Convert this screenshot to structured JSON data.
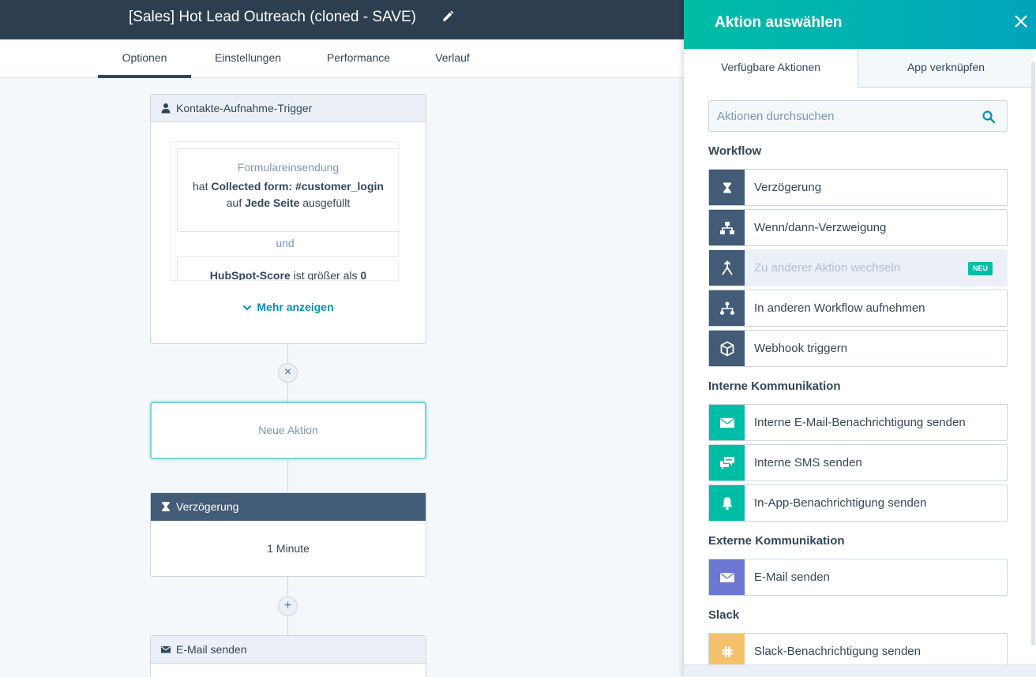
{
  "header": {
    "title": "[Sales] Hot Lead Outreach (cloned - SAVE)",
    "tabs": [
      {
        "label": "Optionen",
        "active": true
      },
      {
        "label": "Einstellungen",
        "active": false
      },
      {
        "label": "Performance",
        "active": false
      },
      {
        "label": "Verlauf",
        "active": false
      }
    ]
  },
  "canvas": {
    "trigger": {
      "title": "Kontakte-Aufnahme-Trigger",
      "filter1": {
        "title": "Formulareinsendung",
        "line1_prefix": "hat",
        "line1_value": "Collected form: #customer_login",
        "line2_prefix": "auf",
        "line2_value": "Jede Seite",
        "line2_suffix": "ausgefüllt"
      },
      "connector": "und",
      "filter2": {
        "field": "HubSpot-Score",
        "operator": "ist größer als",
        "value": "0"
      },
      "show_more": "Mehr anzeigen"
    },
    "remove_symbol": "×",
    "new_action": "Neue Aktion",
    "delay": {
      "title": "Verzögerung",
      "value": "1 Minute"
    },
    "add_symbol": "+",
    "email": {
      "title": "E-Mail senden"
    }
  },
  "panel": {
    "title": "Aktion auswählen",
    "tabs": [
      {
        "label": "Verfügbare Aktionen",
        "active": true
      },
      {
        "label": "App verknüpfen",
        "active": false
      }
    ],
    "search_placeholder": "Aktionen durchsuchen",
    "sections": {
      "workflow": "Workflow",
      "internal": "Interne Kommunikation",
      "external": "Externe Kommunikation",
      "slack": "Slack"
    },
    "actions": {
      "delay": {
        "label": "Verzögerung",
        "icon": "hourglass-icon"
      },
      "branch": {
        "label": "Wenn/dann-Verzweigung",
        "icon": "branch-icon"
      },
      "goto": {
        "label": "Zu anderer Aktion wechseln",
        "icon": "merge-arrow-icon",
        "badge": "NEU",
        "disabled": true
      },
      "enroll": {
        "label": "In anderen Workflow aufnehmen",
        "icon": "workflow-icon"
      },
      "webhook": {
        "label": "Webhook triggern",
        "icon": "cube-icon"
      },
      "internal_email": {
        "label": "Interne E-Mail-Benachrichtigung senden",
        "icon": "envelope-icon"
      },
      "internal_sms": {
        "label": "Interne SMS senden",
        "icon": "chat-icon"
      },
      "inapp": {
        "label": "In-App-Benachrichtigung senden",
        "icon": "bell-icon"
      },
      "send_email": {
        "label": "E-Mail senden",
        "icon": "envelope-icon"
      },
      "slack": {
        "label": "Slack-Benachrichtigung senden",
        "icon": "slack-icon"
      }
    }
  },
  "colors": {
    "header_bg": "#2d3e50",
    "accent_teal": "#00bda5",
    "accent_blue": "#00a4bd",
    "dark_icon_bg": "#425b76",
    "purple_icon_bg": "#6a78d1",
    "yellow_icon_bg": "#f5c26b"
  }
}
